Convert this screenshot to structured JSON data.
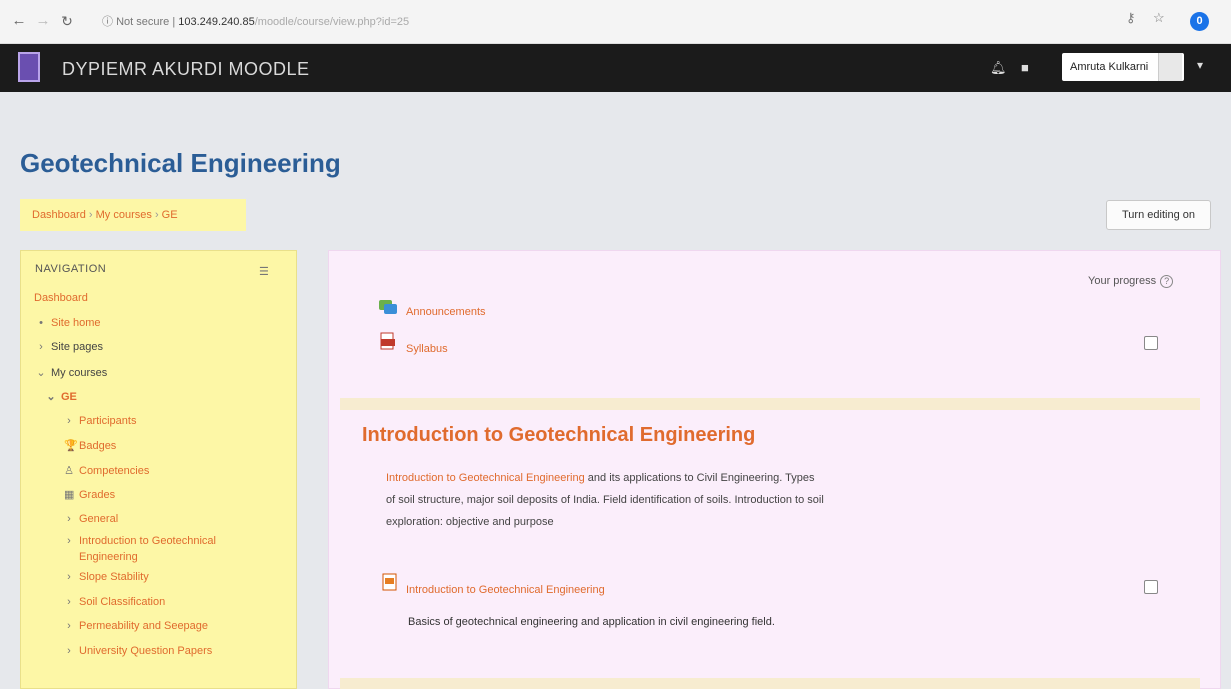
{
  "browser": {
    "security": "Not secure",
    "host": "103.249.240.85",
    "path": "/moodle/course/view.php?id=25",
    "extension_count": "0"
  },
  "navbar": {
    "site_name": "DYPIEMR AKURDI MOODLE",
    "user_name": "Amruta Kulkarni"
  },
  "page": {
    "title": "Geotechnical Engineering",
    "breadcrumb": [
      "Dashboard",
      "My courses",
      "GE"
    ],
    "edit_button": "Turn editing on"
  },
  "navigation": {
    "heading": "NAVIGATION",
    "items": [
      {
        "label": "Dashboard",
        "indent": 0,
        "icon": "",
        "style": "link"
      },
      {
        "label": "Site home",
        "indent": 1,
        "icon": "•",
        "style": "link"
      },
      {
        "label": "Site pages",
        "indent": 1,
        "icon": "›",
        "style": "dark"
      },
      {
        "label": "My courses",
        "indent": 1,
        "icon": "⌄",
        "style": "dark"
      },
      {
        "label": "GE",
        "indent": 2,
        "icon": "⌄",
        "style": "bold"
      },
      {
        "label": "Participants",
        "indent": 3,
        "icon": "›",
        "style": "link"
      },
      {
        "label": "Badges",
        "indent": 3,
        "icon": "🏆",
        "style": "link"
      },
      {
        "label": "Competencies",
        "indent": 3,
        "icon": "♙",
        "style": "link"
      },
      {
        "label": "Grades",
        "indent": 3,
        "icon": "▦",
        "style": "link"
      },
      {
        "label": "General",
        "indent": 3,
        "icon": "›",
        "style": "link"
      },
      {
        "label": "Introduction to Geotechnical",
        "label2": "Engineering",
        "indent": 3,
        "icon": "›",
        "style": "link"
      },
      {
        "label": "Slope Stability",
        "indent": 3,
        "icon": "›",
        "style": "link"
      },
      {
        "label": "Soil Classification",
        "indent": 3,
        "icon": "›",
        "style": "link"
      },
      {
        "label": "Permeability and Seepage",
        "indent": 3,
        "icon": "›",
        "style": "link"
      },
      {
        "label": "University Question Papers",
        "indent": 3,
        "icon": "›",
        "style": "link"
      }
    ]
  },
  "main": {
    "progress_label": "Your progress",
    "activities_top": [
      {
        "label": "Announcements",
        "icon": "forum-icon"
      },
      {
        "label": "Syllabus",
        "icon": "pdf-icon"
      }
    ],
    "section": {
      "title": "Introduction to Geotechnical Engineering",
      "summary_link": "Introduction to Geotechnical Engineering",
      "summary_line1_rest": " and its applications to Civil Engineering. Types",
      "summary_line2": "of soil structure, major soil deposits of India. Field identification of soils. Introduction to soil",
      "summary_line3": "exploration: objective and purpose",
      "activity": {
        "label": "Introduction to Geotechnical Engineering",
        "icon": "ppt-icon",
        "description": "Basics of geotechnical engineering and application in civil engineering field."
      }
    }
  }
}
